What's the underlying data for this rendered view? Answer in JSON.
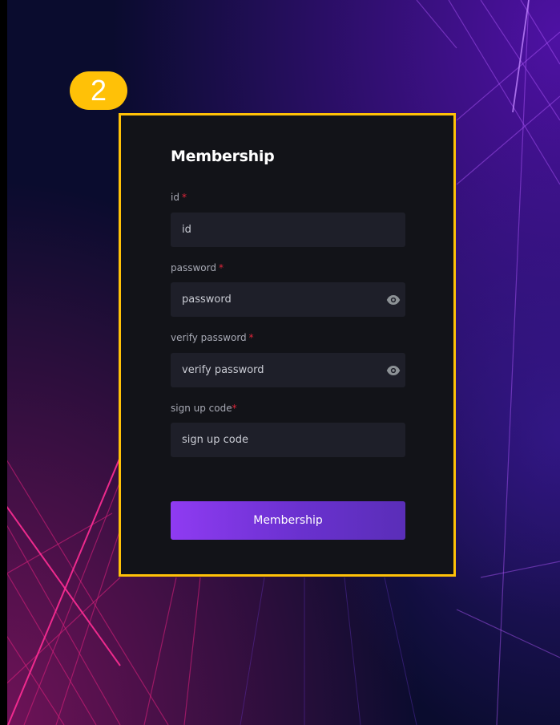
{
  "step_badge": "2",
  "form": {
    "title": "Membership",
    "fields": [
      {
        "label": "id",
        "required_mark": "*",
        "placeholder": "id",
        "value": ""
      },
      {
        "label": "password",
        "required_mark": "*",
        "placeholder": "password",
        "value": "",
        "icon": "eye-icon"
      },
      {
        "label": "verify password",
        "required_mark": "*",
        "placeholder": "verify password",
        "value": "",
        "icon": "eye-icon"
      },
      {
        "label": "sign up code",
        "required_mark": "*",
        "placeholder": "sign up code",
        "value": ""
      }
    ],
    "submit_label": "Membership"
  },
  "colors": {
    "background": "#0a0c2e",
    "card": "#121318",
    "highlight_border": "#ffc107",
    "input_bg": "#1e1f29",
    "required": "#e0263a",
    "button_start": "#8f3bf2",
    "button_end": "#5a2eb8"
  }
}
